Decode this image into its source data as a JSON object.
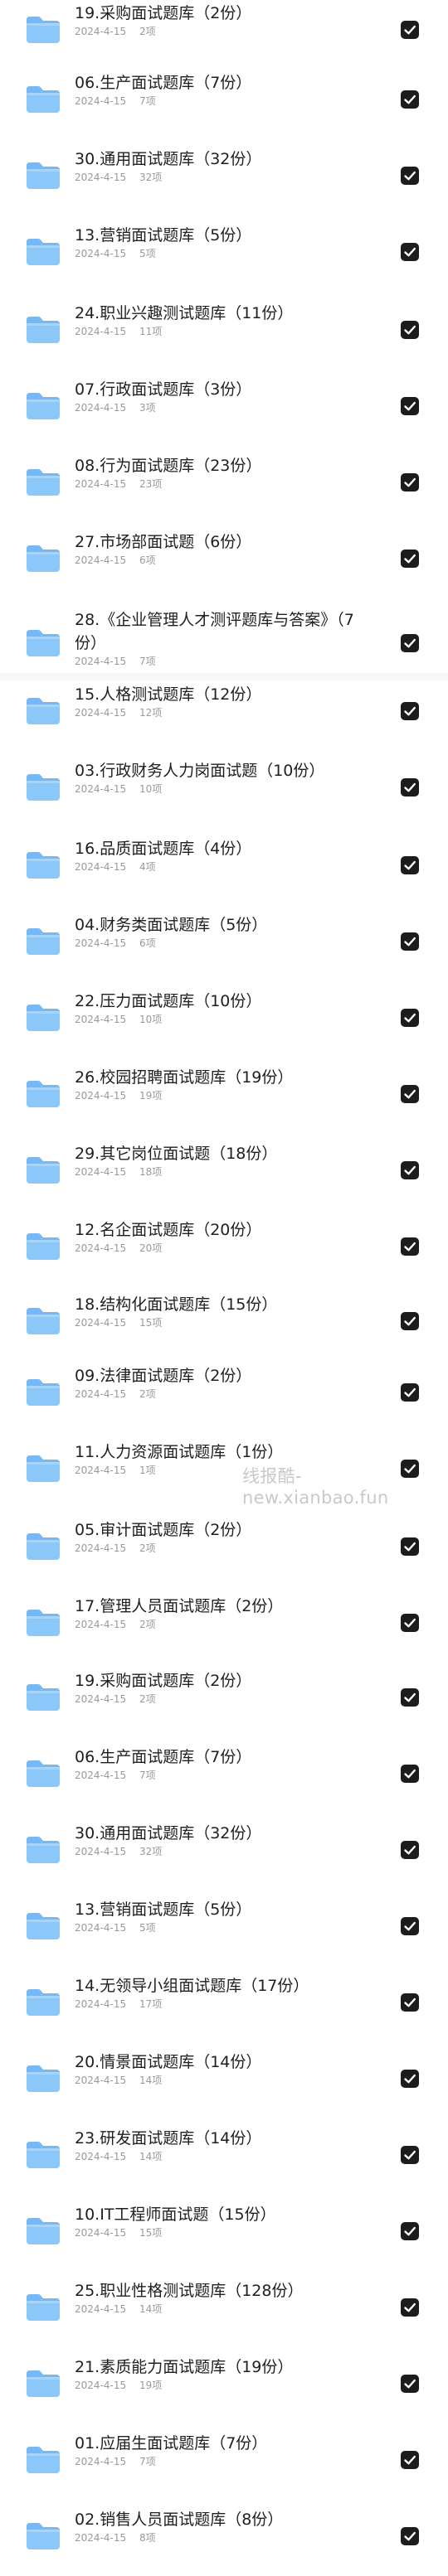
{
  "watermark": "线报酷-new.xianbao.fun",
  "items": [
    {
      "title": "19.采购面试题库（2份）",
      "date": "2024-4-15",
      "count": "2项",
      "checked": true
    },
    {
      "title": "06.生产面试题库（7份）",
      "date": "2024-4-15",
      "count": "7项",
      "checked": true
    },
    {
      "title": "30.通用面试题库（32份）",
      "date": "2024-4-15",
      "count": "32项",
      "checked": true
    },
    {
      "title": "13.营销面试题库（5份）",
      "date": "2024-4-15",
      "count": "5项",
      "checked": true
    },
    {
      "title": "24.职业兴趣测试题库（11份）",
      "date": "2024-4-15",
      "count": "11项",
      "checked": true
    },
    {
      "title": "07.行政面试题库（3份）",
      "date": "2024-4-15",
      "count": "3项",
      "checked": true
    },
    {
      "title": "08.行为面试题库（23份）",
      "date": "2024-4-15",
      "count": "23项",
      "checked": true
    },
    {
      "title": "27.市场部面试题（6份）",
      "date": "2024-4-15",
      "count": "6项",
      "checked": true
    },
    {
      "title": "28.《企业管理人才测评题库与答案》（7份）",
      "date": "2024-4-15",
      "count": "7项",
      "checked": true
    },
    {
      "title": "15.人格测试题库（12份）",
      "date": "2024-4-15",
      "count": "12项",
      "checked": true
    },
    {
      "title": "03.行政财务人力岗面试题（10份）",
      "date": "2024-4-15",
      "count": "10项",
      "checked": true
    },
    {
      "title": "16.品质面试题库（4份）",
      "date": "2024-4-15",
      "count": "4项",
      "checked": true
    },
    {
      "title": "04.财务类面试题库（5份）",
      "date": "2024-4-15",
      "count": "6项",
      "checked": true
    },
    {
      "title": "22.压力面试题库（10份）",
      "date": "2024-4-15",
      "count": "10项",
      "checked": true
    },
    {
      "title": "26.校园招聘面试题库（19份）",
      "date": "2024-4-15",
      "count": "19项",
      "checked": true
    },
    {
      "title": "29.其它岗位面试题（18份）",
      "date": "2024-4-15",
      "count": "18项",
      "checked": true
    },
    {
      "title": "12.名企面试题库（20份）",
      "date": "2024-4-15",
      "count": "20项",
      "checked": true
    },
    {
      "title": "18.结构化面试题库（15份）",
      "date": "2024-4-15",
      "count": "15项",
      "checked": true
    },
    {
      "title": "09.法律面试题库（2份）",
      "date": "2024-4-15",
      "count": "2项",
      "checked": true
    },
    {
      "title": "11.人力资源面试题库（1份）",
      "date": "2024-4-15",
      "count": "1项",
      "checked": true
    },
    {
      "title": "05.审计面试题库（2份）",
      "date": "2024-4-15",
      "count": "2项",
      "checked": true
    },
    {
      "title": "17.管理人员面试题库（2份）",
      "date": "2024-4-15",
      "count": "2项",
      "checked": true
    },
    {
      "title": "19.采购面试题库（2份）",
      "date": "2024-4-15",
      "count": "2项",
      "checked": true
    },
    {
      "title": "06.生产面试题库（7份）",
      "date": "2024-4-15",
      "count": "7项",
      "checked": true
    },
    {
      "title": "30.通用面试题库（32份）",
      "date": "2024-4-15",
      "count": "32项",
      "checked": true
    },
    {
      "title": "13.营销面试题库（5份）",
      "date": "2024-4-15",
      "count": "5项",
      "checked": true
    },
    {
      "title": "14.无领导小组面试题库（17份）",
      "date": "2024-4-15",
      "count": "17项",
      "checked": true
    },
    {
      "title": "20.情景面试题库（14份）",
      "date": "2024-4-15",
      "count": "14项",
      "checked": true
    },
    {
      "title": "23.研发面试题库（14份）",
      "date": "2024-4-15",
      "count": "14项",
      "checked": true
    },
    {
      "title": "10.IT工程师面试题（15份）",
      "date": "2024-4-15",
      "count": "15项",
      "checked": true
    },
    {
      "title": "25.职业性格测试题库（128份）",
      "date": "2024-4-15",
      "count": "14项",
      "checked": true
    },
    {
      "title": "21.素质能力面试题库（19份）",
      "date": "2024-4-15",
      "count": "19项",
      "checked": true
    },
    {
      "title": "01.应届生面试题库（7份）",
      "date": "2024-4-15",
      "count": "7项",
      "checked": true
    },
    {
      "title": "02.销售人员面试题库（8份）",
      "date": "2024-4-15",
      "count": "8项",
      "checked": true
    }
  ]
}
